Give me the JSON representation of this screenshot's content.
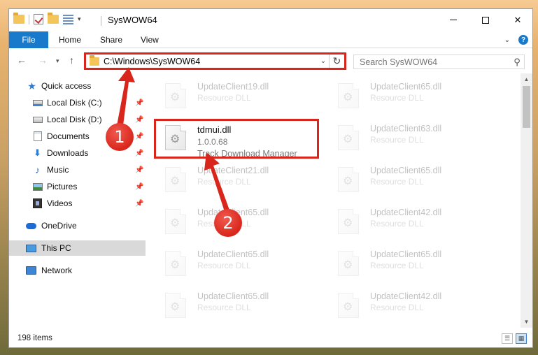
{
  "window": {
    "title": "SysWOW64"
  },
  "ribbon": {
    "file_tab": "File",
    "tabs": [
      "Home",
      "Share",
      "View"
    ]
  },
  "navbar": {
    "address": "C:\\Windows\\SysWOW64",
    "search_placeholder": "Search SysWOW64"
  },
  "sidebar": {
    "items": [
      {
        "label": "Quick access",
        "icon": "star-icon"
      },
      {
        "label": "Local Disk (C:)",
        "icon": "disk-icon",
        "pinned": true
      },
      {
        "label": "Local Disk (D:)",
        "icon": "disk-icon",
        "pinned": true
      },
      {
        "label": "Documents",
        "icon": "documents-icon",
        "pinned": true
      },
      {
        "label": "Downloads",
        "icon": "downloads-icon",
        "pinned": true
      },
      {
        "label": "Music",
        "icon": "music-icon",
        "pinned": true
      },
      {
        "label": "Pictures",
        "icon": "pictures-icon",
        "pinned": true
      },
      {
        "label": "Videos",
        "icon": "videos-icon",
        "pinned": true
      },
      {
        "label": "OneDrive",
        "icon": "onedrive-icon"
      },
      {
        "label": "This PC",
        "icon": "this-pc-icon",
        "selected": true
      },
      {
        "label": "Network",
        "icon": "network-icon"
      }
    ]
  },
  "files": {
    "featured": {
      "name": "tdmui.dll",
      "version": "1.0.0.68",
      "description": "Track Download Manager"
    },
    "left_column": [
      {
        "name": "UpdateClient19.dll",
        "description": "Resource DLL"
      },
      {
        "name": "UpdateClient21.dll",
        "description": "Resource DLL"
      },
      {
        "name": "UpdateClient65.dll",
        "description": "Resource DLL"
      },
      {
        "name": "UpdateClient65.dll",
        "description": "Resource DLL"
      },
      {
        "name": "UpdateClient65.dll",
        "description": "Resource DLL"
      }
    ],
    "right_column": [
      {
        "name": "UpdateClient65.dll",
        "description": "Resource DLL"
      },
      {
        "name": "UpdateClient63.dll",
        "description": "Resource DLL"
      },
      {
        "name": "UpdateClient65.dll",
        "description": "Resource DLL"
      },
      {
        "name": "UpdateClient42.dll",
        "description": "Resource DLL"
      },
      {
        "name": "UpdateClient65.dll",
        "description": "Resource DLL"
      },
      {
        "name": "UpdateClient42.dll",
        "description": "Resource DLL"
      }
    ]
  },
  "status": {
    "item_count": "198 items"
  },
  "annotations": {
    "step1": "1",
    "step2": "2",
    "color": "#d9261c"
  }
}
